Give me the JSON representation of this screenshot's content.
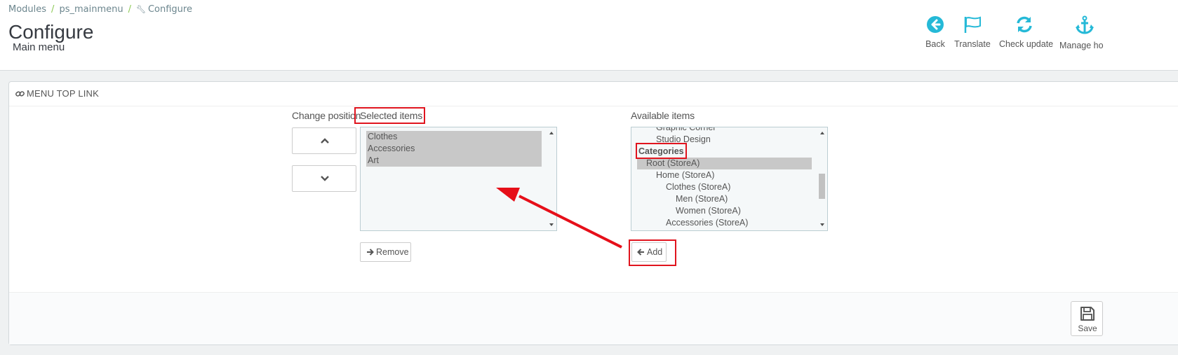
{
  "breadcrumb": {
    "items": [
      "Modules",
      "ps_mainmenu",
      "Configure"
    ]
  },
  "page": {
    "title": "Configure",
    "subtitle": "Main menu"
  },
  "toolbar": {
    "back": "Back",
    "translate": "Translate",
    "check_update": "Check update",
    "manage_hooks": "Manage ho"
  },
  "panel": {
    "heading": "MENU TOP LINK"
  },
  "labels": {
    "change_position": "Change position",
    "selected_items": "Selected items",
    "available_items": "Available items"
  },
  "selected_items": [
    "Clothes",
    "Accessories",
    "Art"
  ],
  "available_items": [
    "Graphic Corner",
    "Studio Design",
    "Categories",
    "Root (StoreA)",
    "Home (StoreA)",
    "Clothes (StoreA)",
    "Men (StoreA)",
    "Women (StoreA)",
    "Accessories (StoreA)"
  ],
  "buttons": {
    "remove": "Remove",
    "add": "Add",
    "save": "Save"
  },
  "colors": {
    "accent": "#25b9d7",
    "highlight": "#e0141e",
    "selection": "#c8c8c8"
  }
}
